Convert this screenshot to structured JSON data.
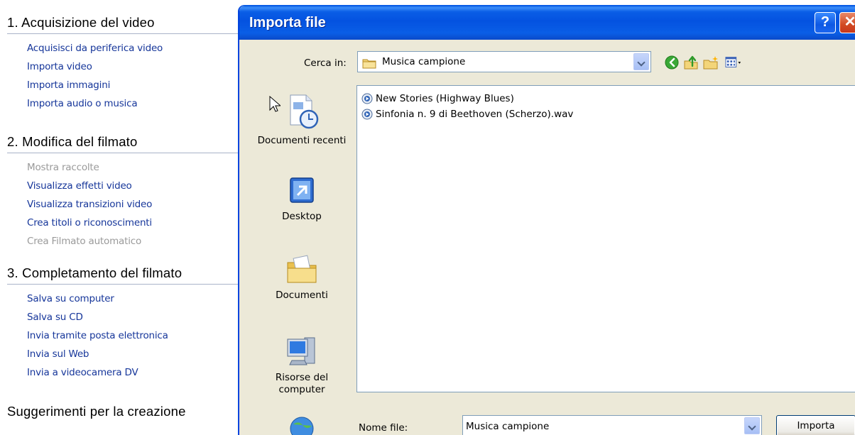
{
  "taskpane": {
    "sections": [
      {
        "title": "1. Acquisizione del video",
        "items": [
          {
            "label": "Acquisisci da periferica video",
            "enabled": true
          },
          {
            "label": "Importa video",
            "enabled": true
          },
          {
            "label": "Importa immagini",
            "enabled": true
          },
          {
            "label": "Importa audio o musica",
            "enabled": true
          }
        ]
      },
      {
        "title": "2. Modifica del filmato",
        "items": [
          {
            "label": "Mostra raccolte",
            "enabled": false
          },
          {
            "label": "Visualizza effetti video",
            "enabled": true
          },
          {
            "label": "Visualizza transizioni video",
            "enabled": true
          },
          {
            "label": "Crea titoli o riconoscimenti",
            "enabled": true
          },
          {
            "label": "Crea Filmato automatico",
            "enabled": false
          }
        ]
      },
      {
        "title": "3. Completamento del filmato",
        "items": [
          {
            "label": "Salva su computer",
            "enabled": true
          },
          {
            "label": "Salva su CD",
            "enabled": true
          },
          {
            "label": "Invia tramite posta elettronica",
            "enabled": true
          },
          {
            "label": "Invia sul Web",
            "enabled": true
          },
          {
            "label": "Invia a videocamera DV",
            "enabled": true
          }
        ]
      },
      {
        "title": "Suggerimenti per la creazione",
        "items": []
      }
    ]
  },
  "dialog": {
    "title": "Importa file",
    "help_glyph": "?",
    "close_glyph": "✕",
    "look_in_label": "Cerca in:",
    "look_in_value": "Musica campione",
    "places": [
      {
        "label": "Documenti recenti",
        "icon": "recent-documents-icon"
      },
      {
        "label": "Desktop",
        "icon": "desktop-icon"
      },
      {
        "label": "Documenti",
        "icon": "my-documents-icon"
      },
      {
        "label": "Risorse del computer",
        "icon": "my-computer-icon"
      },
      {
        "label": "",
        "icon": "network-places-icon"
      }
    ],
    "files": [
      {
        "name": "New Stories (Highway Blues)",
        "icon": "audio-file-icon"
      },
      {
        "name": "Sinfonia n. 9 di Beethoven (Scherzo).wav",
        "icon": "audio-file-icon"
      }
    ],
    "file_name_label": "Nome file:",
    "file_name_value": "Musica campione",
    "import_button": "Importa"
  },
  "colors": {
    "link": "#16369a",
    "disabled": "#9a9a9a",
    "titlebar": "#0a5ee6",
    "dialog_bg": "#ece9d8"
  }
}
